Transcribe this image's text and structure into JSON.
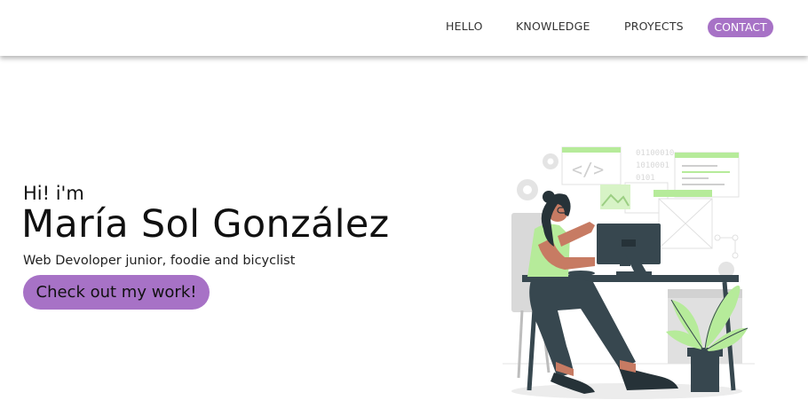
{
  "nav": {
    "items": [
      {
        "label": "HELLO"
      },
      {
        "label": "KNOWLEDGE"
      },
      {
        "label": "PROYECTS"
      }
    ],
    "cta_label": "CONTACT"
  },
  "hero": {
    "greeting": "Hi! i'm",
    "name": "María Sol González",
    "tagline": "Web Devoloper junior, foodie and bicyclist",
    "button_label": "Check out my work!"
  },
  "illustration": {
    "binary_text_1": "01100010",
    "binary_text_2": "1010001",
    "binary_text_3": "0101"
  },
  "colors": {
    "accent": "#a772c6",
    "illustration_green": "#b6eb9a",
    "illustration_dark": "#37474f",
    "skin": "#c77b63"
  }
}
